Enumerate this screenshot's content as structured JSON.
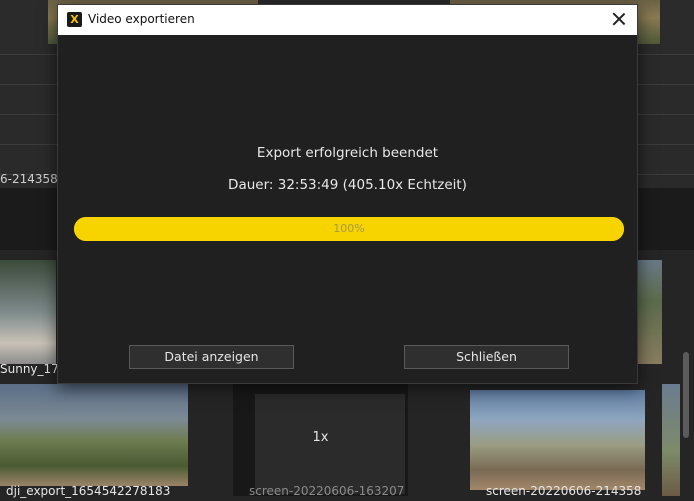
{
  "background": {
    "clip_label": "6-214358",
    "media_items": [
      {
        "label": "Sunny_17-",
        "dim": false
      },
      {
        "label": "dji_export_1654542278183",
        "dim": false
      },
      {
        "label": "screen-20220606-163207",
        "dim": true
      },
      {
        "label": "screen-20220606-214358",
        "dim": false
      }
    ],
    "speed_badge": "1x"
  },
  "dialog": {
    "title": "Video exportieren",
    "app_icon_glyph": "X",
    "message": "Export erfolgreich beendet",
    "duration": "Dauer: 32:53:49 (405.10x Echtzeit)",
    "progress": {
      "value": 1.0,
      "label": "100%"
    },
    "buttons": {
      "show_file": "Datei anzeigen",
      "close": "Schließen"
    }
  },
  "colors": {
    "accent": "#f7d300",
    "dialog_bg": "#202020",
    "titlebar_bg": "#ffffff"
  }
}
